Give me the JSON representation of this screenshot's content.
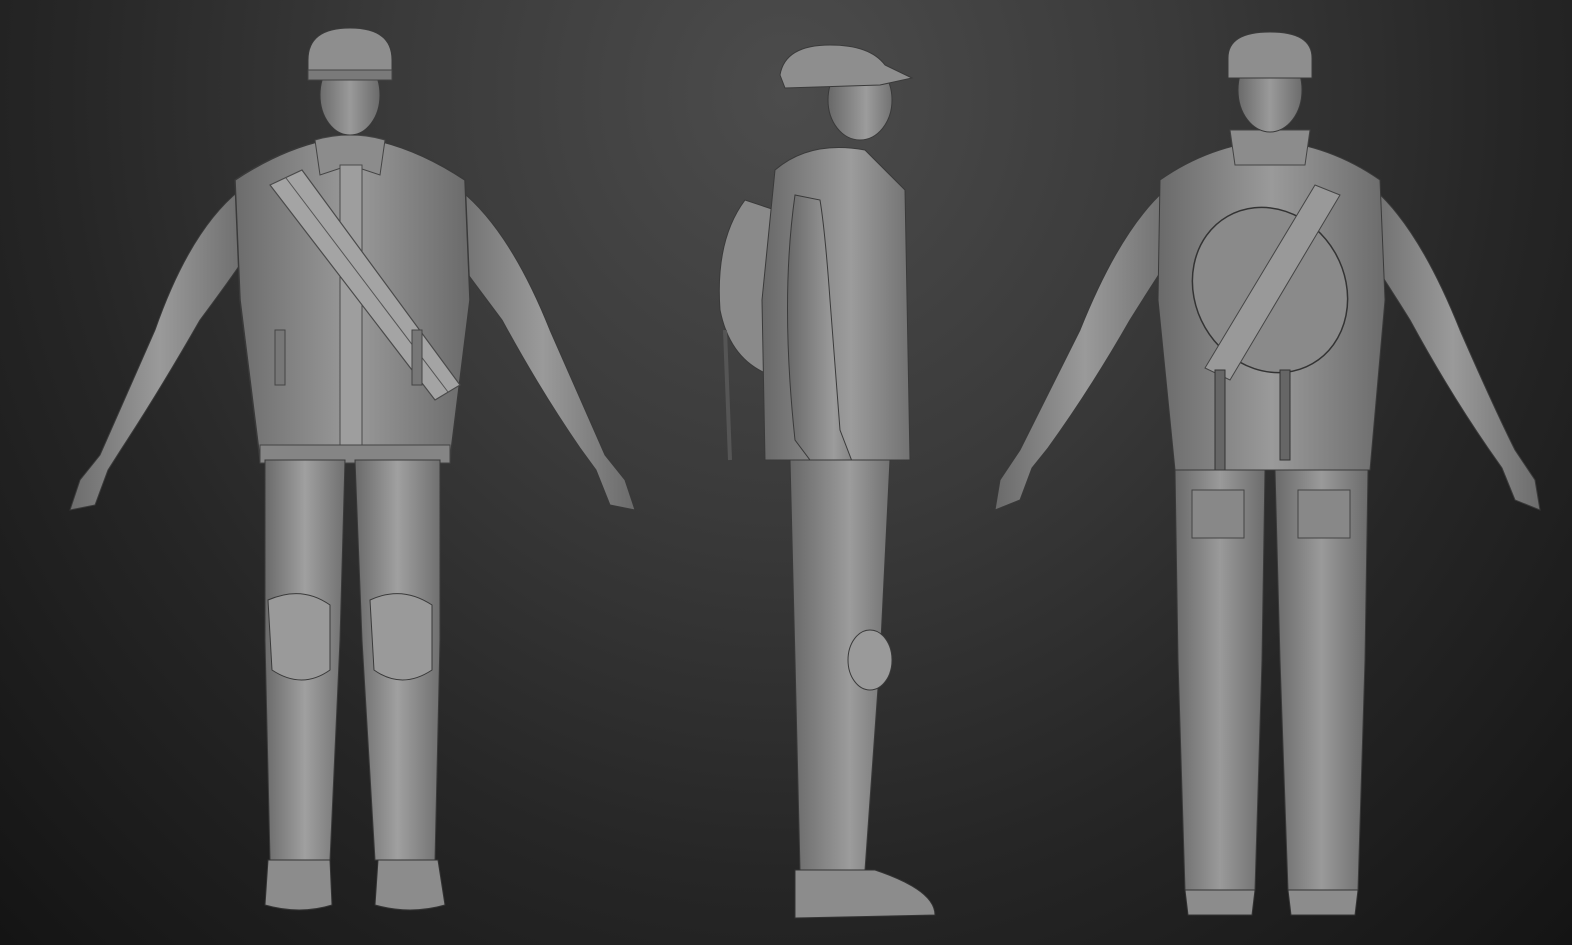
{
  "scene": {
    "background": {
      "top_color": "#4c4c4c",
      "bottom_color": "#141414"
    },
    "material_color": "#8a8a8a",
    "views": [
      {
        "id": "front",
        "semantic": "character-front-view"
      },
      {
        "id": "side",
        "semantic": "character-side-view"
      },
      {
        "id": "back",
        "semantic": "character-back-view"
      }
    ],
    "character": {
      "outfit": [
        "cap",
        "leather-jacket",
        "shoulder-strap",
        "backpack",
        "jeans",
        "knee-pads",
        "sneakers"
      ]
    }
  }
}
